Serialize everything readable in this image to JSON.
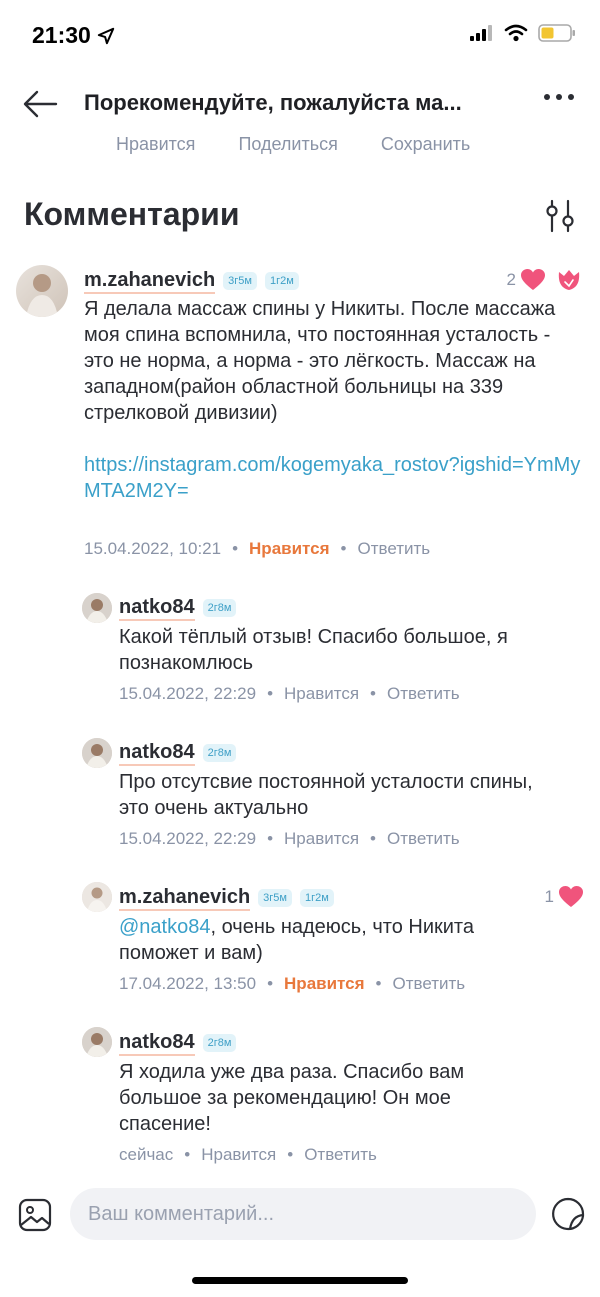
{
  "status_bar": {
    "time": "21:30",
    "icons": [
      "location-arrow-icon",
      "signal-icon",
      "wifi-icon",
      "battery-icon"
    ]
  },
  "header": {
    "title": "Порекомендуйте, пожалуйста ма..."
  },
  "actions": {
    "like": "Нравится",
    "share": "Поделиться",
    "save": "Сохранить"
  },
  "comments_title": "Комментарии",
  "comments": [
    {
      "author": "m.zahanevich",
      "badges": [
        "3г5м",
        "1г2м"
      ],
      "likes": "2",
      "text": "Я делала массаж спины у Никиты. После массажа моя спина вспомнила, что постоянная усталость - это не норма, а норма - это лёгкость. Массаж на западном(район областной больницы на 339 стрелковой дивизии)",
      "link": "https://instagram.com/kogemyaka_rostov?igshid=YmMyMTA2M2Y=",
      "date": "15.04.2022, 10:21",
      "like_label": "Нравится",
      "reply_label": "Ответить"
    },
    {
      "author": "natko84",
      "badges": [
        "2г8м"
      ],
      "text": "Какой тёплый отзыв! Спасибо большое, я познакомлюсь",
      "date": "15.04.2022, 22:29",
      "like_label": "Нравится",
      "reply_label": "Ответить"
    },
    {
      "author": "natko84",
      "badges": [
        "2г8м"
      ],
      "text": "Про отсутсвие постоянной усталости спины, это очень актуально",
      "date": "15.04.2022, 22:29",
      "like_label": "Нравится",
      "reply_label": "Ответить"
    },
    {
      "author": "m.zahanevich",
      "badges": [
        "3г5м",
        "1г2м"
      ],
      "likes": "1",
      "mention": "@natko84",
      "text": ", очень надеюсь, что Никита поможет и вам)",
      "date": "17.04.2022, 13:50",
      "like_label": "Нравится",
      "reply_label": "Ответить"
    },
    {
      "author": "natko84",
      "badges": [
        "2г8м"
      ],
      "text": "Я ходила уже два раза. Спасибо вам большое за рекомендацию! Он мое спасение!",
      "date": "сейчас",
      "like_label": "Нравится",
      "reply_label": "Ответить"
    }
  ],
  "input": {
    "placeholder": "Ваш комментарий..."
  },
  "colors": {
    "accent_link": "#3aa0c9",
    "liked": "#e8783c",
    "heart": "#f0547c",
    "badge_bg": "#e2f3f9"
  }
}
